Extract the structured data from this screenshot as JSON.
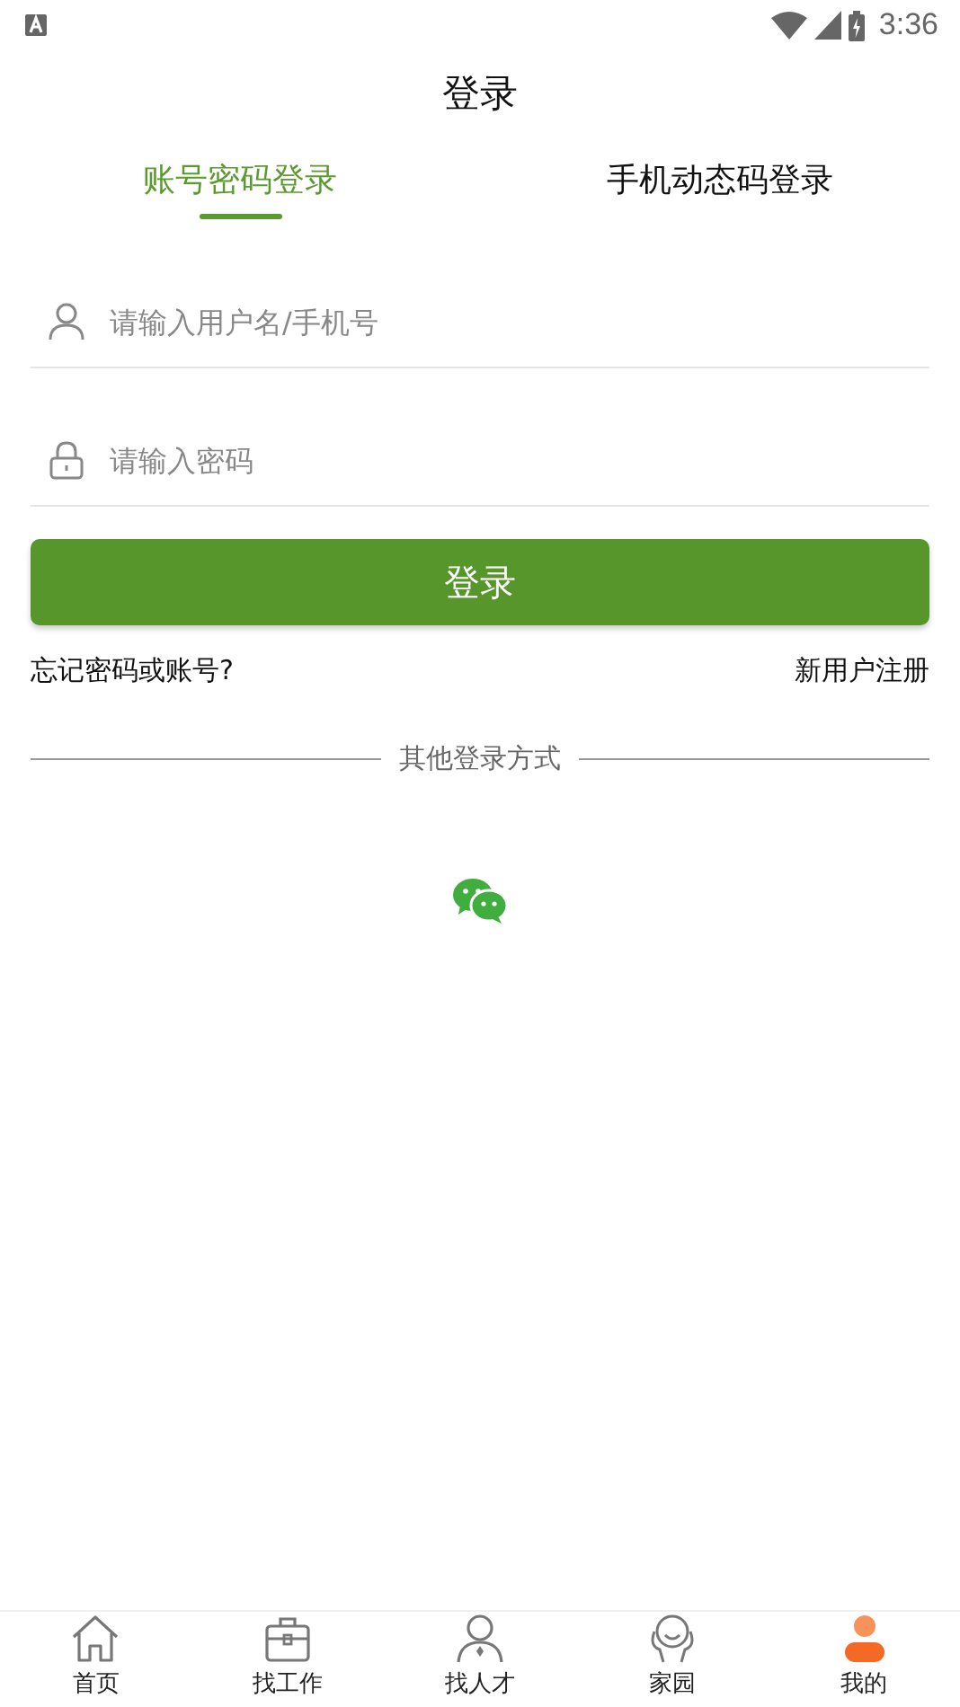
{
  "status_bar": {
    "time": "3:36"
  },
  "title": "登录",
  "tabs": [
    {
      "label": "账号密码登录",
      "selected": true
    },
    {
      "label": "手机动态码登录",
      "selected": false
    }
  ],
  "fields": [
    {
      "placeholder": "请输入用户名/手机号"
    },
    {
      "placeholder": "请输入密码"
    }
  ],
  "login_button": "登录",
  "forgot_link": "忘记密码或账号?",
  "register_link": "新用户注册",
  "other_methods": "其他登录方式",
  "nav": [
    {
      "label": "首页",
      "selected": false
    },
    {
      "label": "找工作",
      "selected": false
    },
    {
      "label": "找人才",
      "selected": false
    },
    {
      "label": "家园",
      "selected": false
    },
    {
      "label": "我的",
      "selected": true
    }
  ]
}
